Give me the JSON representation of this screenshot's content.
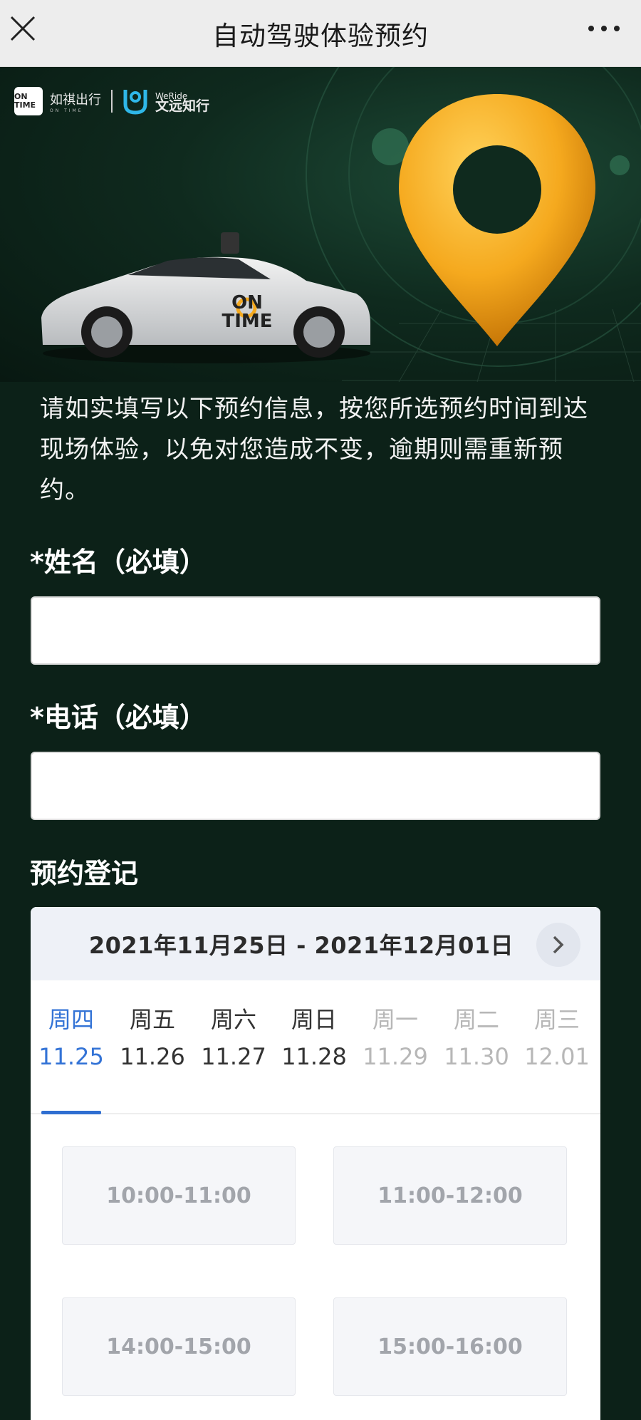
{
  "topbar": {
    "title": "自动驾驶体验预约"
  },
  "hero": {
    "brand1": "如祺出行",
    "brand1_sub": "ON TIME",
    "brand1_badge": "ON TIME",
    "brand2_en": "WeRide",
    "brand2_cn": "文远知行",
    "car_text": "ON TIME",
    "accent": "#f5a91e"
  },
  "intro": "请如实填写以下预约信息，按您所选预约时间到达现场体验，以免对您造成不变，逾期则需重新预约。",
  "form": {
    "name_label": "*姓名（必填）",
    "name_value": "",
    "phone_label": "*电话（必填）",
    "phone_value": ""
  },
  "booking": {
    "section_label": "预约登记",
    "range": "2021年11月25日 - 2021年12月01日",
    "days": [
      {
        "weekday": "周四",
        "date": "11.25",
        "state": "active"
      },
      {
        "weekday": "周五",
        "date": "11.26",
        "state": "normal"
      },
      {
        "weekday": "周六",
        "date": "11.27",
        "state": "normal"
      },
      {
        "weekday": "周日",
        "date": "11.28",
        "state": "normal"
      },
      {
        "weekday": "周一",
        "date": "11.29",
        "state": "disabled"
      },
      {
        "weekday": "周二",
        "date": "11.30",
        "state": "disabled"
      },
      {
        "weekday": "周三",
        "date": "12.01",
        "state": "disabled"
      }
    ],
    "slots": [
      "10:00-11:00",
      "11:00-12:00",
      "14:00-15:00",
      "15:00-16:00"
    ]
  }
}
